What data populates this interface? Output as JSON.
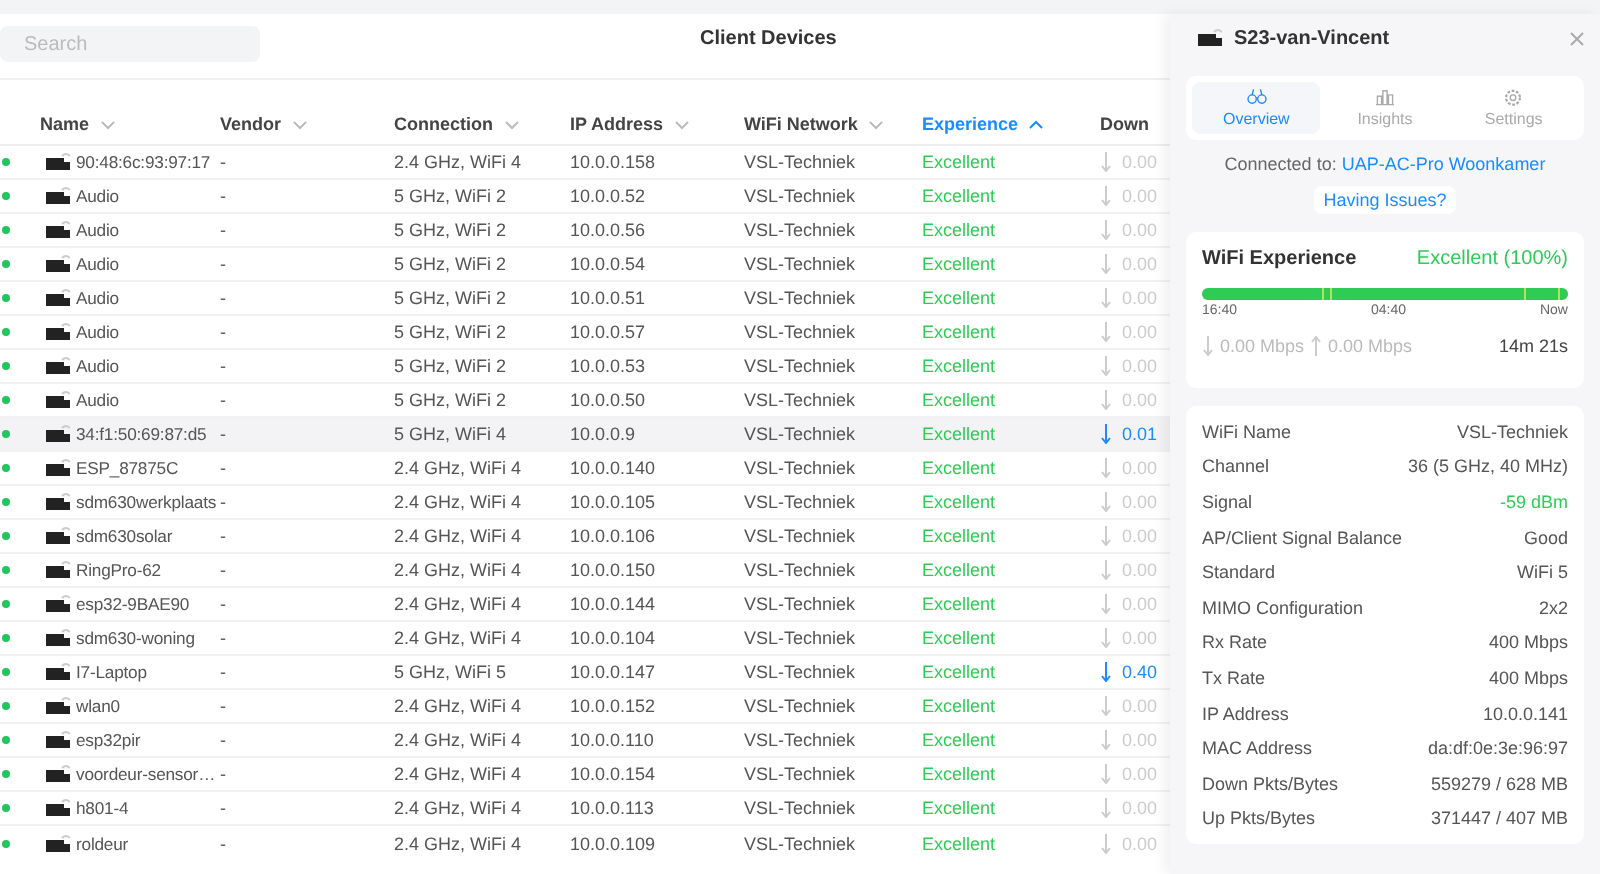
{
  "search": {
    "placeholder": "Search"
  },
  "title": "Client Devices",
  "columns": [
    {
      "label": "Name",
      "sortable": true,
      "active": false
    },
    {
      "label": "Vendor",
      "sortable": true,
      "active": false
    },
    {
      "label": "Connection",
      "sortable": true,
      "active": false
    },
    {
      "label": "IP Address",
      "sortable": true,
      "active": false
    },
    {
      "label": "WiFi Network",
      "sortable": true,
      "active": false
    },
    {
      "label": "Experience",
      "sortable": true,
      "active": true
    },
    {
      "label": "Down",
      "sortable": false,
      "active": false
    }
  ],
  "rows": [
    {
      "online": true,
      "name": "90:48:6c:93:97:17",
      "vendor": "-",
      "connection": "2.4 GHz, WiFi 4",
      "ip": "10.0.0.158",
      "network": "VSL-Techniek",
      "experience": "Excellent",
      "down": "0.00",
      "down_active": false,
      "selected": false
    },
    {
      "online": true,
      "name": "Audio",
      "vendor": "-",
      "connection": "5 GHz, WiFi 2",
      "ip": "10.0.0.52",
      "network": "VSL-Techniek",
      "experience": "Excellent",
      "down": "0.00",
      "down_active": false,
      "selected": false
    },
    {
      "online": true,
      "name": "Audio",
      "vendor": "-",
      "connection": "5 GHz, WiFi 2",
      "ip": "10.0.0.56",
      "network": "VSL-Techniek",
      "experience": "Excellent",
      "down": "0.00",
      "down_active": false,
      "selected": false
    },
    {
      "online": true,
      "name": "Audio",
      "vendor": "-",
      "connection": "5 GHz, WiFi 2",
      "ip": "10.0.0.54",
      "network": "VSL-Techniek",
      "experience": "Excellent",
      "down": "0.00",
      "down_active": false,
      "selected": false
    },
    {
      "online": true,
      "name": "Audio",
      "vendor": "-",
      "connection": "5 GHz, WiFi 2",
      "ip": "10.0.0.51",
      "network": "VSL-Techniek",
      "experience": "Excellent",
      "down": "0.00",
      "down_active": false,
      "selected": false
    },
    {
      "online": true,
      "name": "Audio",
      "vendor": "-",
      "connection": "5 GHz, WiFi 2",
      "ip": "10.0.0.57",
      "network": "VSL-Techniek",
      "experience": "Excellent",
      "down": "0.00",
      "down_active": false,
      "selected": false
    },
    {
      "online": true,
      "name": "Audio",
      "vendor": "-",
      "connection": "5 GHz, WiFi 2",
      "ip": "10.0.0.53",
      "network": "VSL-Techniek",
      "experience": "Excellent",
      "down": "0.00",
      "down_active": false,
      "selected": false
    },
    {
      "online": true,
      "name": "Audio",
      "vendor": "-",
      "connection": "5 GHz, WiFi 2",
      "ip": "10.0.0.50",
      "network": "VSL-Techniek",
      "experience": "Excellent",
      "down": "0.00",
      "down_active": false,
      "selected": false
    },
    {
      "online": true,
      "name": "34:f1:50:69:87:d5",
      "vendor": "-",
      "connection": "5 GHz, WiFi 4",
      "ip": "10.0.0.9",
      "network": "VSL-Techniek",
      "experience": "Excellent",
      "down": "0.01",
      "down_active": true,
      "selected": true
    },
    {
      "online": true,
      "name": "ESP_87875C",
      "vendor": "-",
      "connection": "2.4 GHz, WiFi 4",
      "ip": "10.0.0.140",
      "network": "VSL-Techniek",
      "experience": "Excellent",
      "down": "0.00",
      "down_active": false,
      "selected": false
    },
    {
      "online": true,
      "name": "sdm630werkplaats",
      "vendor": "-",
      "connection": "2.4 GHz, WiFi 4",
      "ip": "10.0.0.105",
      "network": "VSL-Techniek",
      "experience": "Excellent",
      "down": "0.00",
      "down_active": false,
      "selected": false
    },
    {
      "online": true,
      "name": "sdm630solar",
      "vendor": "-",
      "connection": "2.4 GHz, WiFi 4",
      "ip": "10.0.0.106",
      "network": "VSL-Techniek",
      "experience": "Excellent",
      "down": "0.00",
      "down_active": false,
      "selected": false
    },
    {
      "online": true,
      "name": "RingPro-62",
      "vendor": "-",
      "connection": "2.4 GHz, WiFi 4",
      "ip": "10.0.0.150",
      "network": "VSL-Techniek",
      "experience": "Excellent",
      "down": "0.00",
      "down_active": false,
      "selected": false
    },
    {
      "online": true,
      "name": "esp32-9BAE90",
      "vendor": "-",
      "connection": "2.4 GHz, WiFi 4",
      "ip": "10.0.0.144",
      "network": "VSL-Techniek",
      "experience": "Excellent",
      "down": "0.00",
      "down_active": false,
      "selected": false
    },
    {
      "online": true,
      "name": "sdm630-woning",
      "vendor": "-",
      "connection": "2.4 GHz, WiFi 4",
      "ip": "10.0.0.104",
      "network": "VSL-Techniek",
      "experience": "Excellent",
      "down": "0.00",
      "down_active": false,
      "selected": false
    },
    {
      "online": true,
      "name": "I7-Laptop",
      "vendor": "-",
      "connection": "5 GHz, WiFi 5",
      "ip": "10.0.0.147",
      "network": "VSL-Techniek",
      "experience": "Excellent",
      "down": "0.40",
      "down_active": true,
      "selected": false
    },
    {
      "online": true,
      "name": "wlan0",
      "vendor": "-",
      "connection": "2.4 GHz, WiFi 4",
      "ip": "10.0.0.152",
      "network": "VSL-Techniek",
      "experience": "Excellent",
      "down": "0.00",
      "down_active": false,
      "selected": false
    },
    {
      "online": true,
      "name": "esp32pir",
      "vendor": "-",
      "connection": "2.4 GHz, WiFi 4",
      "ip": "10.0.0.110",
      "network": "VSL-Techniek",
      "experience": "Excellent",
      "down": "0.00",
      "down_active": false,
      "selected": false
    },
    {
      "online": true,
      "name": "voordeur-sensor…",
      "vendor": "-",
      "connection": "2.4 GHz, WiFi 4",
      "ip": "10.0.0.154",
      "network": "VSL-Techniek",
      "experience": "Excellent",
      "down": "0.00",
      "down_active": false,
      "selected": false
    },
    {
      "online": true,
      "name": "h801-4",
      "vendor": "-",
      "connection": "2.4 GHz, WiFi 4",
      "ip": "10.0.0.113",
      "network": "VSL-Techniek",
      "experience": "Excellent",
      "down": "0.00",
      "down_active": false,
      "selected": false
    },
    {
      "online": true,
      "name": "roldeur",
      "vendor": "-",
      "connection": "2.4 GHz, WiFi 4",
      "ip": "10.0.0.109",
      "network": "VSL-Techniek",
      "experience": "Excellent",
      "down": "0.00",
      "down_active": false,
      "selected": false
    }
  ],
  "panel": {
    "device_name": "S23-van-Vincent",
    "tabs": [
      {
        "label": "Overview",
        "kind": "overview",
        "selected": true
      },
      {
        "label": "Insights",
        "kind": "insights",
        "selected": false
      },
      {
        "label": "Settings",
        "kind": "settings",
        "selected": false
      }
    ],
    "connected_label": "Connected to:",
    "connected_ap": "UAP-AC-Pro Woonkamer",
    "issues_link": "Having Issues?",
    "experience": {
      "title": "WiFi Experience",
      "rating": "Excellent (100%)",
      "level": 1,
      "time_start": "16:40",
      "time_mid": "04:40",
      "time_end": "Now",
      "down_rate": "0.00 Mbps",
      "up_rate": "0.00 Mbps",
      "uptime": "14m 21s"
    },
    "details": [
      {
        "label": "WiFi Name",
        "value": "VSL-Techniek",
        "good": false
      },
      {
        "label": "Channel",
        "value": "36 (5 GHz, 40 MHz)",
        "good": false
      },
      {
        "label": "Signal",
        "value": "-59 dBm",
        "good": true
      },
      {
        "label": "AP/Client Signal Balance",
        "value": "Good",
        "good": false
      },
      {
        "label": "Standard",
        "value": "WiFi 5",
        "good": false
      },
      {
        "label": "MIMO Configuration",
        "value": "2x2",
        "good": false
      },
      {
        "label": "Rx Rate",
        "value": "400 Mbps",
        "good": false
      },
      {
        "label": "Tx Rate",
        "value": "400 Mbps",
        "good": false
      },
      {
        "label": "IP Address",
        "value": "10.0.0.141",
        "good": false
      },
      {
        "label": "MAC Address",
        "value": "da:df:0e:3e:96:97",
        "good": false
      },
      {
        "label": "Down Pkts/Bytes",
        "value": "559279 / 628 MB",
        "good": false
      },
      {
        "label": "Up Pkts/Bytes",
        "value": "371447 / 407 MB",
        "good": false
      }
    ]
  }
}
